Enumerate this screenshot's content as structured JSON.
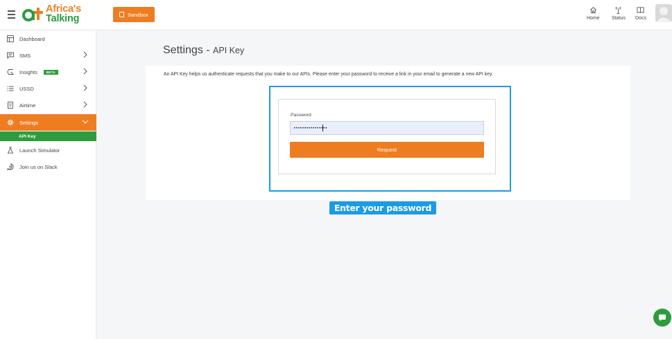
{
  "app": {
    "logo_line1": "Africa's",
    "logo_line2": "Talking",
    "brand_colors": {
      "orange": "#ee7d22",
      "green": "#2d9c3f",
      "highlight_blue": "#1a9be6"
    }
  },
  "header": {
    "environment_label": "Sandbox",
    "nav": [
      {
        "label": "Home",
        "icon": "home-icon"
      },
      {
        "label": "Status",
        "icon": "status-antenna-icon"
      },
      {
        "label": "Docs",
        "icon": "docs-book-icon"
      }
    ]
  },
  "sidebar": {
    "items": [
      {
        "label": "Dashboard",
        "icon": "dashboard-icon",
        "chevron": false
      },
      {
        "label": "SMS",
        "icon": "sms-icon",
        "chevron": true
      },
      {
        "label": "Insights",
        "icon": "insights-icon",
        "badge": "BETA",
        "chevron": true
      },
      {
        "label": "USSD",
        "icon": "ussd-icon",
        "chevron": true
      },
      {
        "label": "Airtime",
        "icon": "airtime-icon",
        "chevron": true
      },
      {
        "label": "Settings",
        "icon": "settings-icon",
        "chevron": true,
        "active": true
      },
      {
        "label": "Launch Simulator",
        "icon": "simulator-icon",
        "chevron": false
      },
      {
        "label": "Join us on Slack",
        "icon": "slack-icon",
        "chevron": false
      }
    ],
    "active_sub_item": "API Key"
  },
  "main": {
    "title": "Settings",
    "title_separator": " - ",
    "subtitle": "API Key",
    "description": "An API Key helps us authenticate requests that you make to our APIs. Please enter your password to receive a link in your email to generate a new API key.",
    "password_label": "Password",
    "password_value": "••••••••••••••••",
    "request_button": "Request",
    "callout": "Enter your password"
  }
}
